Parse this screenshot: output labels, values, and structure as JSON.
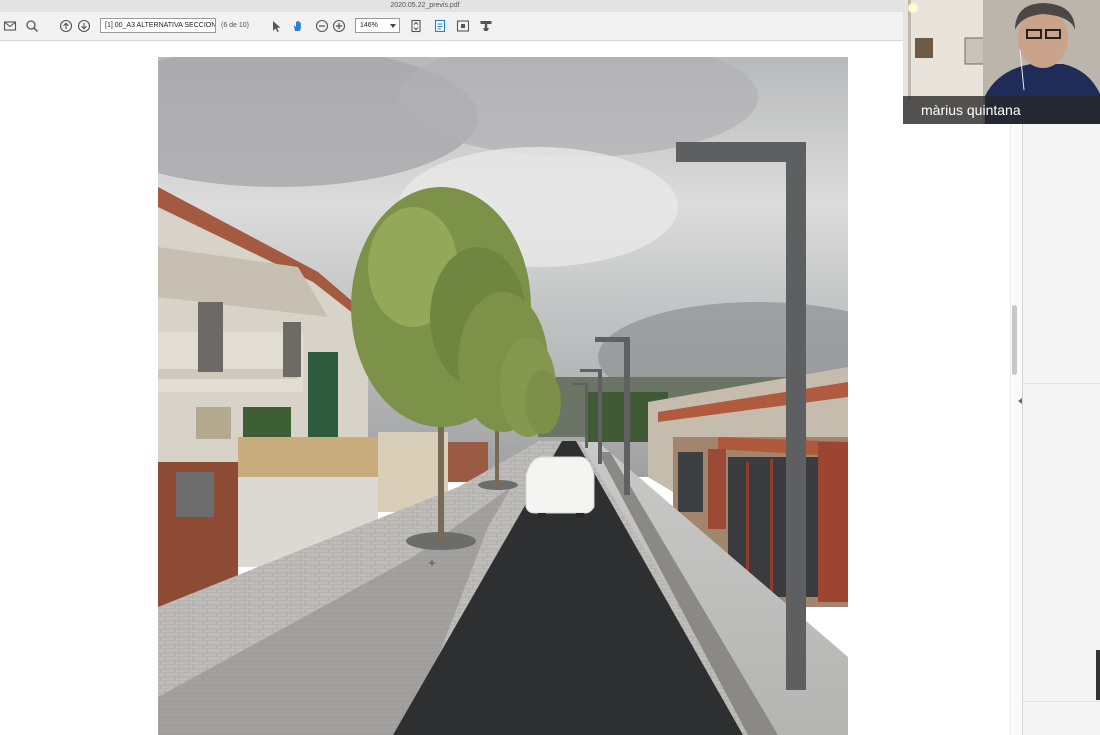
{
  "window": {
    "title": "2020.05.22_previs.pdf"
  },
  "toolbar": {
    "document_select": "[1] 00_A3 ALTERNATIVA SECCIONS",
    "page_count": "(6 de 10)",
    "zoom": "146%",
    "icons": [
      "mail-icon",
      "search-icon",
      "page-up-icon",
      "page-down-icon",
      "select-arrow-icon",
      "hand-tool-icon",
      "zoom-out-icon",
      "zoom-in-icon",
      "fit-page-icon",
      "fit-width-icon",
      "fullscreen-icon",
      "stamp-icon"
    ]
  },
  "video": {
    "participant_name": "màrius quintana"
  },
  "colors": {
    "toolbar": "#f2f2f2",
    "asphalt": "#2e2f31",
    "sky": "#c9cacb",
    "lamp": "#5d5f60"
  }
}
